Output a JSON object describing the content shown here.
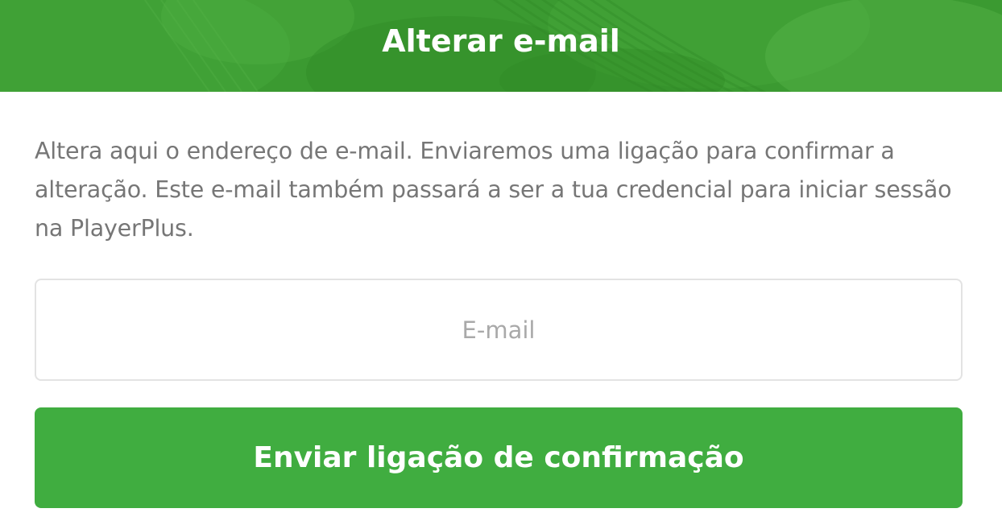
{
  "header": {
    "title": "Alterar e-mail",
    "background_color": "#3a9a30"
  },
  "description": "Altera aqui o endereço de e-mail. Enviaremos uma ligação para confirmar a alteração. Este e-mail também passará a ser a tua credencial para iniciar sessão na PlayerPlus.",
  "email": {
    "value": "",
    "placeholder": "E-mail"
  },
  "submit": {
    "label": "Enviar ligação de confirmação",
    "color": "#40ad40"
  }
}
